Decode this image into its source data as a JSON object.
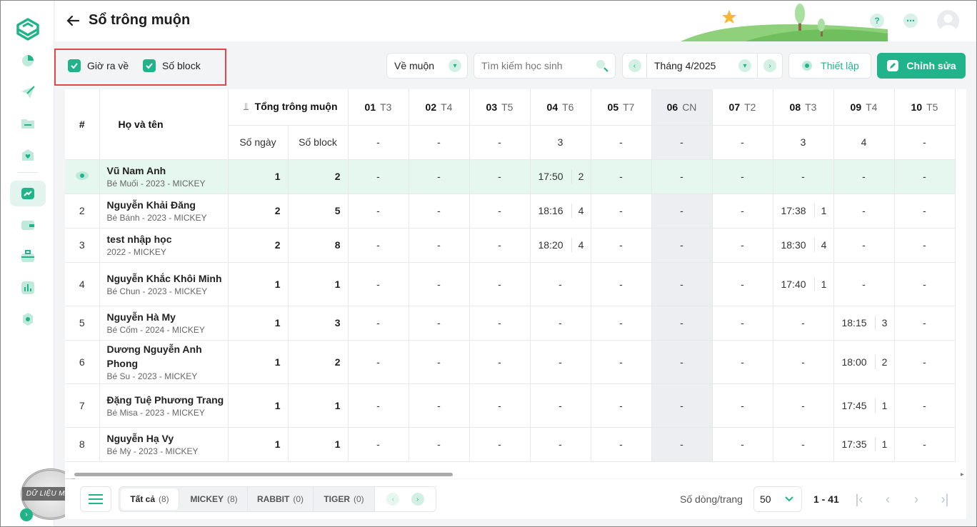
{
  "header": {
    "title": "Sổ trông muộn"
  },
  "options": {
    "show_time_label": "Giờ ra về",
    "show_block_label": "Số block"
  },
  "toolbar": {
    "mode": "Về muộn",
    "search_placeholder": "Tìm kiếm học sinh",
    "month": "Tháng 4/2025",
    "settings_label": "Thiết lập",
    "edit_label": "Chỉnh sửa"
  },
  "table": {
    "col_index": "#",
    "col_name": "Họ và tên",
    "col_total": "Tổng trông muộn",
    "col_days": "Số ngày",
    "col_blocks": "Số block",
    "days": [
      {
        "d": "01",
        "w": "T3",
        "total": "-",
        "weekend": false
      },
      {
        "d": "02",
        "w": "T4",
        "total": "-",
        "weekend": false
      },
      {
        "d": "03",
        "w": "T5",
        "total": "-",
        "weekend": false
      },
      {
        "d": "04",
        "w": "T6",
        "total": "3",
        "weekend": false
      },
      {
        "d": "05",
        "w": "T7",
        "total": "-",
        "weekend": false
      },
      {
        "d": "06",
        "w": "CN",
        "total": "-",
        "weekend": true
      },
      {
        "d": "07",
        "w": "T2",
        "total": "-",
        "weekend": false
      },
      {
        "d": "08",
        "w": "T3",
        "total": "3",
        "weekend": false
      },
      {
        "d": "09",
        "w": "T4",
        "total": "4",
        "weekend": false
      },
      {
        "d": "10",
        "w": "T5",
        "total": "-",
        "weekend": false
      }
    ],
    "rows": [
      {
        "idx": "",
        "name": "Vũ Nam Anh",
        "sub": "Bé Muối - 2023 - MICKEY",
        "days": "1",
        "blocks": "2",
        "cells": [
          "-",
          "-",
          "-",
          "17:50|2",
          "-",
          "-",
          "-",
          "-",
          "-",
          "-"
        ]
      },
      {
        "idx": "2",
        "name": "Nguyễn Khải Đăng",
        "sub": "Bé Bánh - 2023 - MICKEY",
        "days": "2",
        "blocks": "5",
        "cells": [
          "-",
          "-",
          "-",
          "18:16|4",
          "-",
          "-",
          "-",
          "17:38|1",
          "-",
          "-"
        ]
      },
      {
        "idx": "3",
        "name": "test nhập học",
        "sub": "2022 - MICKEY",
        "days": "2",
        "blocks": "8",
        "cells": [
          "-",
          "-",
          "-",
          "18:20|4",
          "-",
          "-",
          "-",
          "18:30|4",
          "-",
          "-"
        ]
      },
      {
        "idx": "4",
        "name": "Nguyễn Khắc Khôi Minh",
        "sub": "Bé Chun - 2023 - MICKEY",
        "days": "1",
        "blocks": "1",
        "cells": [
          "-",
          "-",
          "-",
          "-",
          "-",
          "-",
          "-",
          "17:40|1",
          "-",
          "-"
        ]
      },
      {
        "idx": "5",
        "name": "Nguyễn Hà My",
        "sub": "Bé Cốm - 2024 - MICKEY",
        "days": "1",
        "blocks": "3",
        "cells": [
          "-",
          "-",
          "-",
          "-",
          "-",
          "-",
          "-",
          "-",
          "18:15|3",
          "-"
        ]
      },
      {
        "idx": "6",
        "name": "Dương Nguyễn Anh Phong",
        "sub": "Bé Su - 2023 - MICKEY",
        "days": "1",
        "blocks": "2",
        "cells": [
          "-",
          "-",
          "-",
          "-",
          "-",
          "-",
          "-",
          "-",
          "18:00|2",
          "-"
        ]
      },
      {
        "idx": "7",
        "name": "Đặng Tuệ Phương Trang",
        "sub": "Bé Misa - 2023 - MICKEY",
        "days": "1",
        "blocks": "1",
        "cells": [
          "-",
          "-",
          "-",
          "-",
          "-",
          "-",
          "-",
          "-",
          "17:45|1",
          "-"
        ]
      },
      {
        "idx": "8",
        "name": "Nguyễn Hạ Vy",
        "sub": "Bé Mỳ - 2023 - MICKEY",
        "days": "1",
        "blocks": "1",
        "cells": [
          "-",
          "-",
          "-",
          "-",
          "-",
          "-",
          "-",
          "-",
          "17:35|1",
          "-"
        ]
      }
    ]
  },
  "class_tabs": [
    {
      "label": "Tất cả",
      "count": "(8)"
    },
    {
      "label": "MICKEY",
      "count": "(8)"
    },
    {
      "label": "RABBIT",
      "count": "(0)"
    },
    {
      "label": "TIGER",
      "count": "(0)"
    }
  ],
  "pagination": {
    "rows_label": "Số dòng/trang",
    "page_size": "50",
    "range": "1 - 41"
  },
  "watermark": "DỮ LIỆU MẪU",
  "colors": {
    "accent": "#21b48a",
    "highlight_border": "#e04848",
    "selected_row": "#e6f7f0"
  }
}
